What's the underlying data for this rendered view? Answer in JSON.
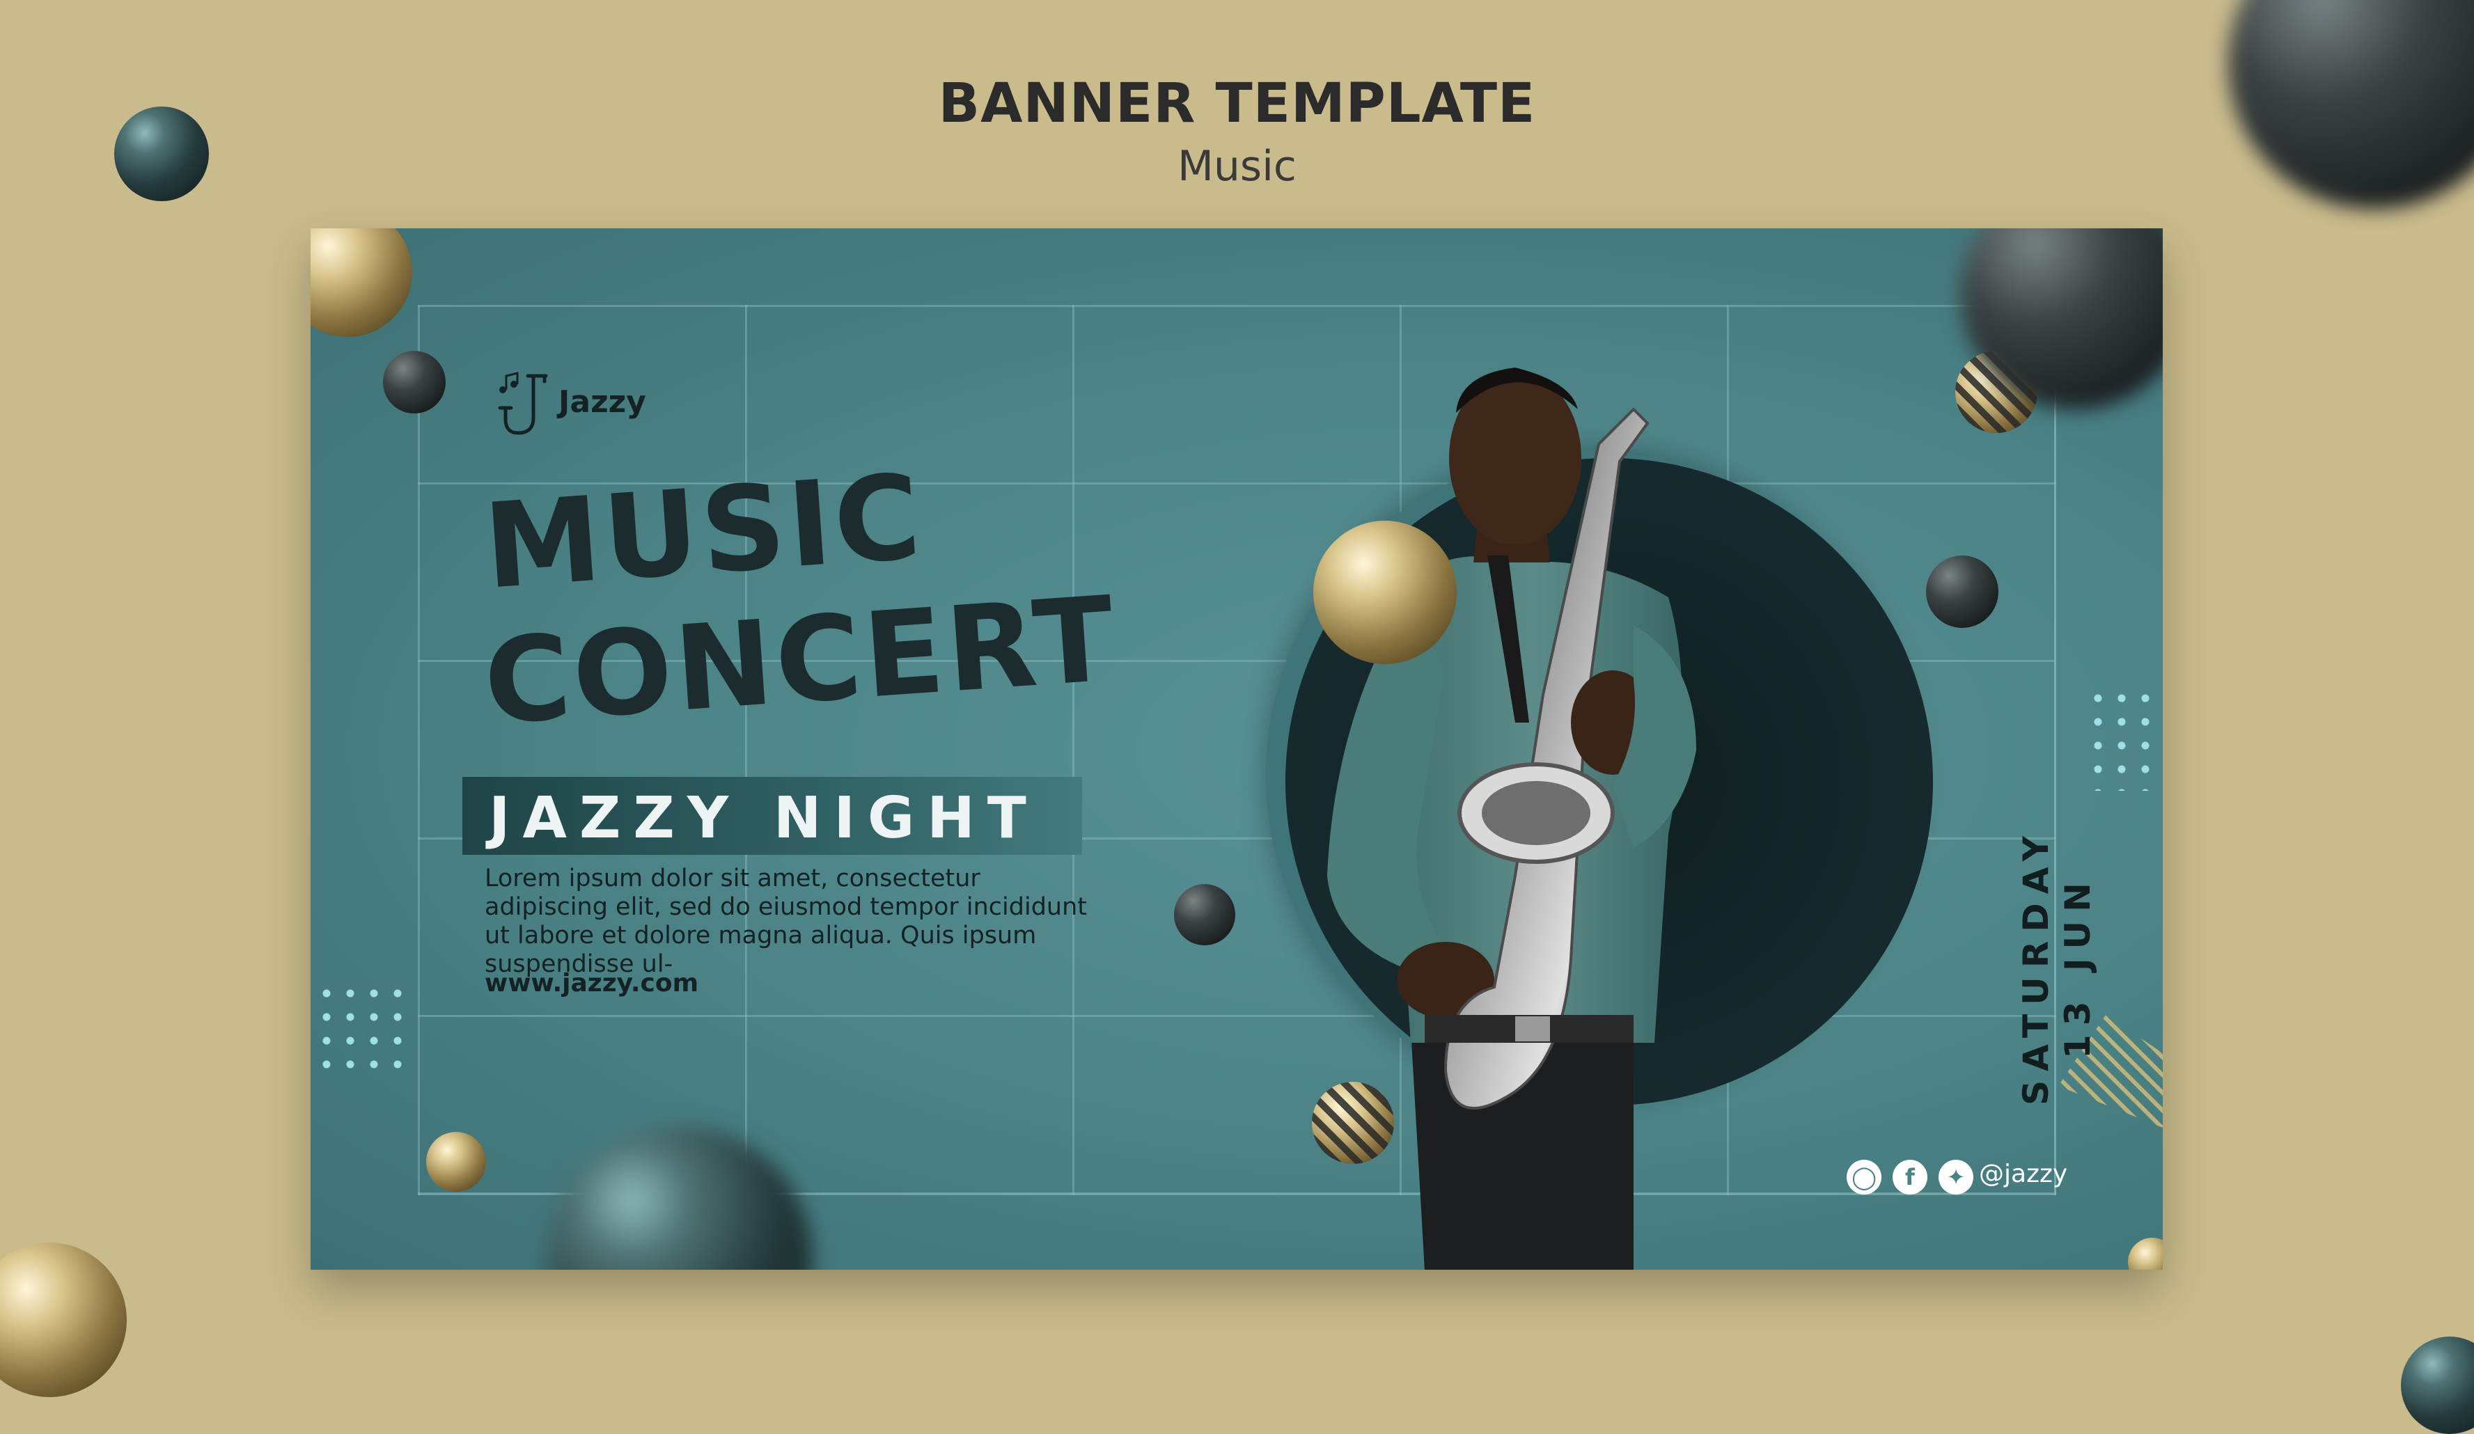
{
  "header": {
    "title": "BANNER TEMPLATE",
    "subtitle": "Music"
  },
  "banner": {
    "brand": "Jazzy",
    "headline_line1": "MUSIC",
    "headline_line2": "CONCERT",
    "subheadline": "JAZZY NIGHT",
    "body": "Lorem ipsum dolor sit amet, consectetur adipiscing elit, sed do eiusmod tempor incididunt ut labore et dolore magna aliqua. Quis ipsum suspendisse ul-",
    "website": "www.jazzy.com",
    "day": "SATURDAY",
    "date": "13 JUN",
    "social_handle": "@jazzy",
    "social_icons": [
      "instagram-icon",
      "facebook-icon",
      "twitter-icon"
    ]
  },
  "colors": {
    "page_background": "#c9bb8c",
    "banner_teal": "#4a8286",
    "headline_dark": "#1c2c2e",
    "accent_dot": "#9fe0e6",
    "gold": "#d8c48a"
  }
}
